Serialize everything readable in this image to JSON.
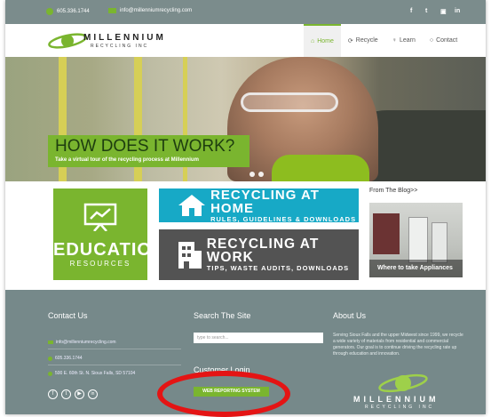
{
  "topbar": {
    "phone": "605.336.1744",
    "email": "info@millenniumrecycling.com",
    "social": [
      "f",
      "t",
      "in"
    ]
  },
  "header": {
    "logo_word": "MILLENNIUM",
    "logo_sub": "RECYCLING INC",
    "nav": [
      {
        "label": "Home",
        "icon": "home-icon"
      },
      {
        "label": "Recycle",
        "icon": "recycle-icon"
      },
      {
        "label": "Learn",
        "icon": "bulb-icon"
      },
      {
        "label": "Contact",
        "icon": "chat-icon"
      }
    ]
  },
  "hero": {
    "title": "HOW DOES IT WORK?",
    "subtitle": "Take a virtual tour of the recycling process at Millennium"
  },
  "tiles": {
    "education_big": "EDUCATION",
    "education_small": "RESOURCES",
    "home_big": "RECYCLING AT HOME",
    "home_small": "RULES, GUIDELINES & DOWNLOADS",
    "work_big": "RECYCLING AT WORK",
    "work_small": "TIPS, WASTE AUDITS, DOWNLOADS"
  },
  "blog": {
    "heading": "From The Blog>>",
    "caption": "Where to take Appliances"
  },
  "footer": {
    "contact_title": "Contact Us",
    "contact_email": "info@millenniumrecycling.com",
    "contact_phone": "605.336.1744",
    "contact_address": "500 E. 60th St. N. Sioux Falls, SD 57104",
    "search_title": "Search The Site",
    "search_placeholder": "type to search...",
    "login_title": "Customer Login",
    "login_button": "WEB REPORTING SYSTEM",
    "about_title": "About Us",
    "about_text": "Serving Sioux Falls and the upper Midwest since 1999, we recycle a wide variety of materials from residential and commercial generators. Our goal is to continue driving the recycling rate up through education and innovation.",
    "logo_word": "MILLENNIUM",
    "logo_sub": "RECYCLING INC"
  },
  "colors": {
    "brand_green": "#7ab52f",
    "teal": "#17a9c6",
    "footer_gray": "#76898a",
    "annotation_red": "#e41414"
  }
}
